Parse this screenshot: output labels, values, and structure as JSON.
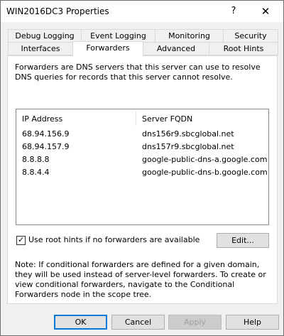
{
  "window": {
    "title": "WIN2016DC3 Properties",
    "help_glyph": "?",
    "close_glyph": "✕"
  },
  "tabs": {
    "row_back": [
      "Debug Logging",
      "Event Logging",
      "Monitoring",
      "Security"
    ],
    "row_front": [
      "Interfaces",
      "Forwarders",
      "Advanced",
      "Root Hints"
    ],
    "active": "Forwarders"
  },
  "forwarders": {
    "intro": "Forwarders are DNS servers that this server can use to resolve DNS queries for records that this server cannot resolve.",
    "columns": [
      "IP Address",
      "Server FQDN"
    ],
    "rows": [
      {
        "ip": "68.94.156.9",
        "fqdn": "dns156r9.sbcglobal.net"
      },
      {
        "ip": "68.94.157.9",
        "fqdn": "dns157r9.sbcglobal.net"
      },
      {
        "ip": "8.8.8.8",
        "fqdn": "google-public-dns-a.google.com"
      },
      {
        "ip": "8.8.4.4",
        "fqdn": "google-public-dns-b.google.com"
      }
    ],
    "use_root_hints_label": "Use root hints if no forwarders are available",
    "use_root_hints_checked": true,
    "check_glyph": "✓",
    "edit_label": "Edit...",
    "note": "Note: If conditional forwarders are defined for a given domain, they will be used instead of server-level forwarders.  To create or view conditional forwarders, navigate to the Conditional Forwarders node in the scope tree."
  },
  "buttons": {
    "ok": "OK",
    "cancel": "Cancel",
    "apply": "Apply",
    "help": "Help"
  }
}
